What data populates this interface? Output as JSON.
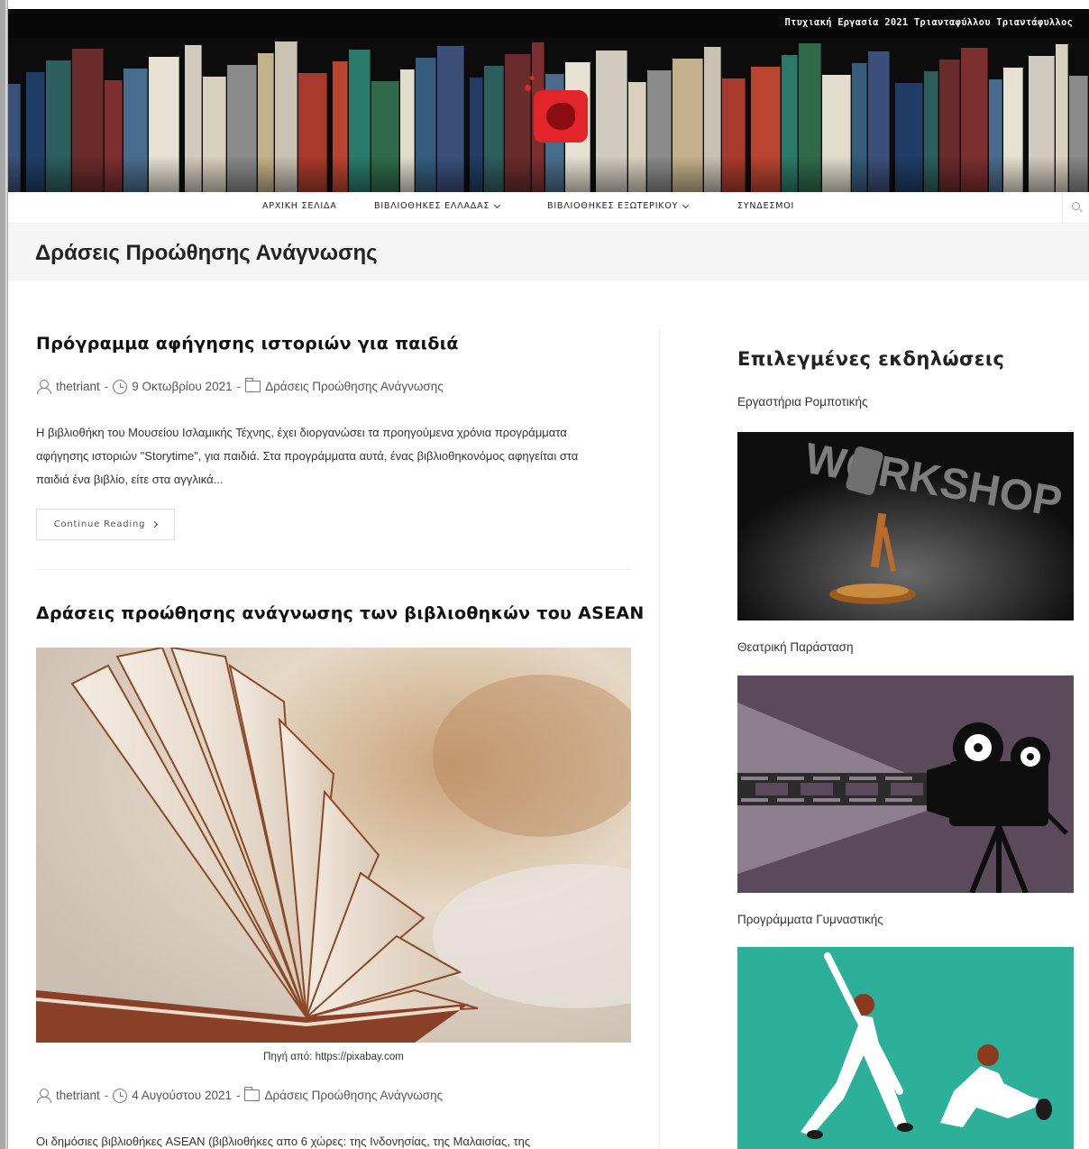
{
  "site": {
    "title": "Πτυχιακή Εργασία 2021 Τριανταφύλλου Τριαντάφυλλος"
  },
  "nav": {
    "items": [
      {
        "label": "ΑΡΧΙΚΗ ΣΕΛΙΔΑ",
        "has_dropdown": false
      },
      {
        "label": "ΒΙΒΛΙΟΘΗΚΕΣ ΕΛΛΑΔΑΣ",
        "has_dropdown": true
      },
      {
        "label": "ΒΙΒΛΙΟΘΗΚΕΣ ΕΞΩΤΕΡΙΚΟΥ",
        "has_dropdown": true
      },
      {
        "label": "ΣΥΝΔΕΣΜΟΙ",
        "has_dropdown": false
      }
    ],
    "search_icon": "search-icon"
  },
  "page": {
    "title": "Δράσεις Προώθησης Ανάγνωσης"
  },
  "posts": [
    {
      "title": "Πρόγραμμα αφήγησης ιστοριών για παιδιά",
      "author": "thetriant",
      "date": "9 Οκτωβρίου 2021",
      "category": "Δράσεις Προώθησης Ανάγνωσης",
      "excerpt": "Η βιβλιοθήκη του Μουσείου Ισλαμικής Τέχνης, έχει διοργανώσει τα προηγούμενα χρόνια προγράμματα αφήγησης ιστοριών \"Storytime\", για παιδιά. Στα προγράμματα αυτά, ένας βιβλιοθηκονόμος αφηγείται στα παιδιά ένα βιβλίο, είτε στα αγγλικά...",
      "button": "Continue Reading"
    },
    {
      "title": "Δράσεις προώθησης ανάγνωσης των βιβλιοθηκών του ASEAN",
      "caption": "Πηγή από: https://pixabay.com",
      "author": "thetriant",
      "date": "4 Αυγούστου 2021",
      "category": "Δράσεις Προώθησης Ανάγνωσης",
      "excerpt": "Οι δημόσιες βιβλιοθήκες ASEAN (βιβλιοθήκες απο 6 χώρες: της Ινδονησίας, της Μαλαισίας, της"
    }
  ],
  "meta_separator": "-",
  "sidebar": {
    "widget_title": "Επιλεγμένες εκδηλώσεις",
    "events": [
      {
        "label": "Εργαστήρια Ρομποτικής",
        "image_text": "WORKSHOP"
      },
      {
        "label": "Θεατρική Παράσταση"
      },
      {
        "label": "Προγράμματα Γυμναστικής"
      }
    ]
  },
  "colors": {
    "logo_red": "#e3242b",
    "page_header_bg": "#f5f5f5",
    "movie_bg": "#5a4a5c",
    "gym_bg": "#2cb09a"
  }
}
